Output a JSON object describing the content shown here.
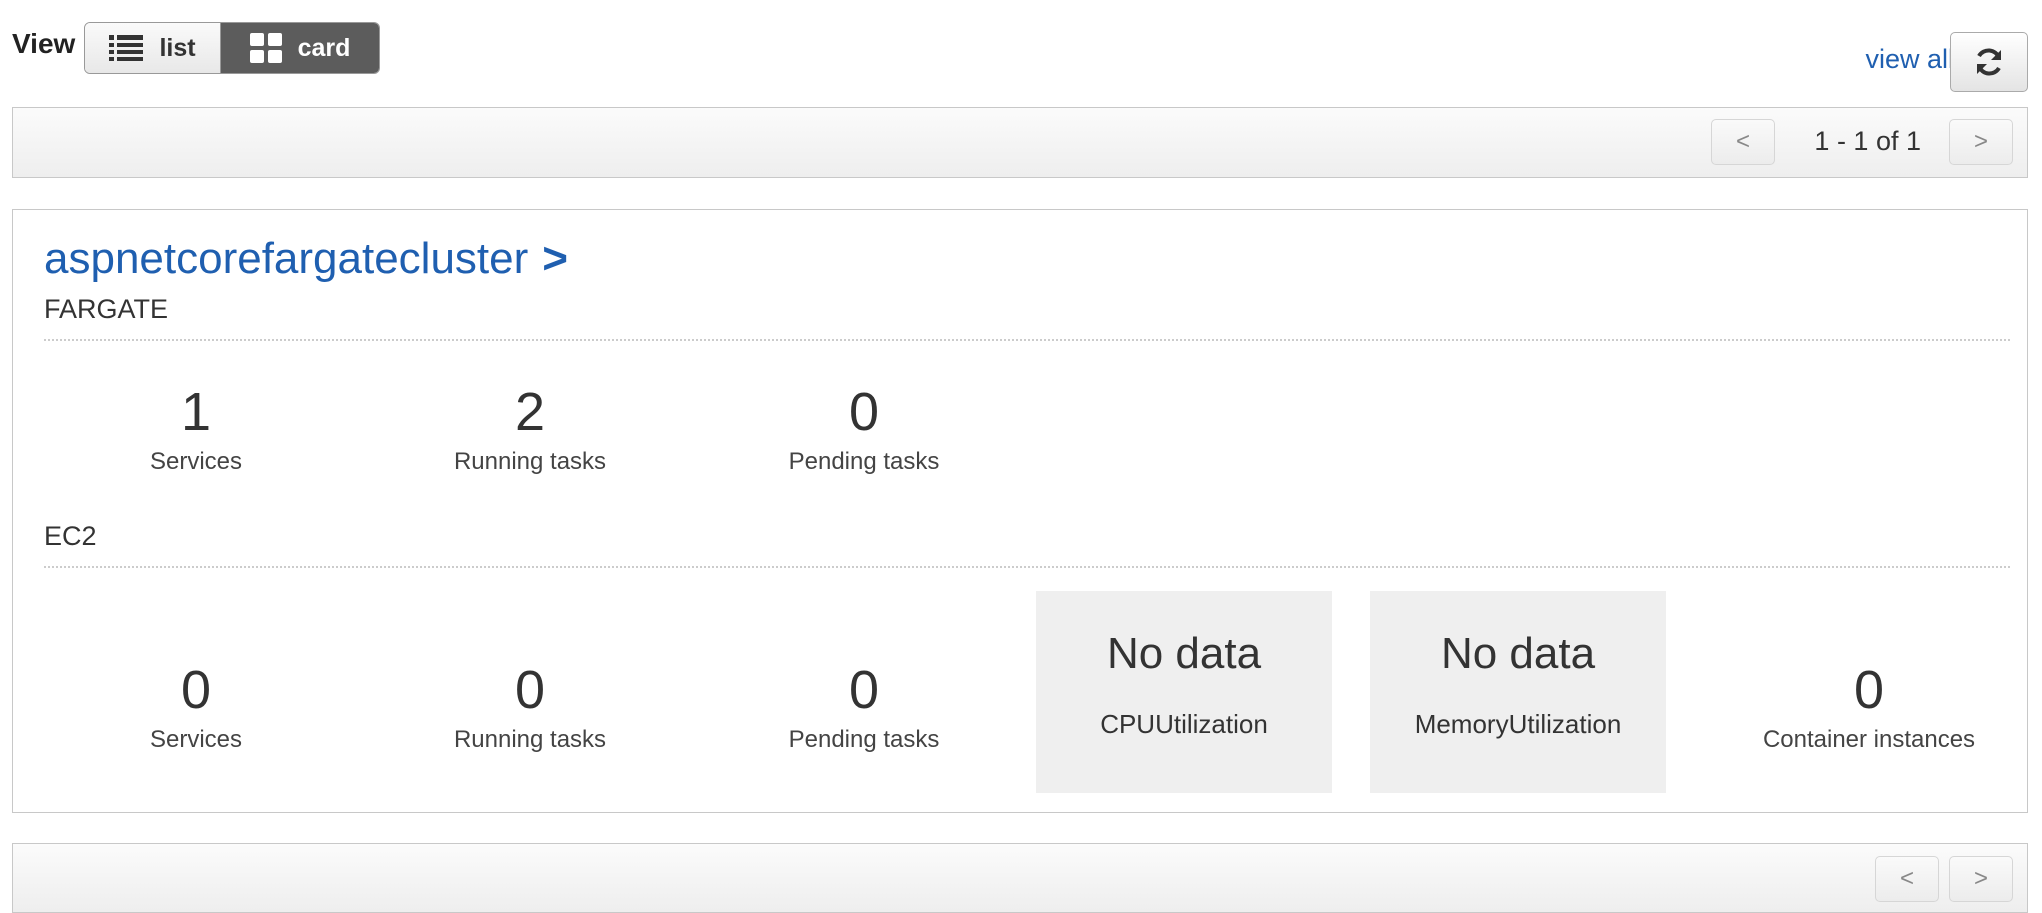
{
  "toolbar": {
    "view_label": "View",
    "list_label": "list",
    "card_label": "card",
    "view_all_label": "view all"
  },
  "pagination": {
    "prev": "<",
    "next": ">",
    "info": "1 - 1 of 1"
  },
  "cluster": {
    "name": "aspnetcorefargatecluster",
    "chevron": ">",
    "fargate": {
      "label": "FARGATE",
      "metrics": [
        {
          "value": "1",
          "label": "Services"
        },
        {
          "value": "2",
          "label": "Running tasks"
        },
        {
          "value": "0",
          "label": "Pending tasks"
        }
      ]
    },
    "ec2": {
      "label": "EC2",
      "metrics": [
        {
          "value": "0",
          "label": "Services"
        },
        {
          "value": "0",
          "label": "Running tasks"
        },
        {
          "value": "0",
          "label": "Pending tasks"
        }
      ],
      "cpu": {
        "value": "No data",
        "label": "CPUUtilization"
      },
      "memory": {
        "value": "No data",
        "label": "MemoryUtilization"
      },
      "instances": {
        "value": "0",
        "label": "Container instances"
      }
    }
  },
  "colors": {
    "link": "#1f5fb0",
    "toggle_active_bg": "#5c5c5c"
  },
  "icons": [
    "list-icon",
    "grid-icon",
    "refresh-icon"
  ]
}
